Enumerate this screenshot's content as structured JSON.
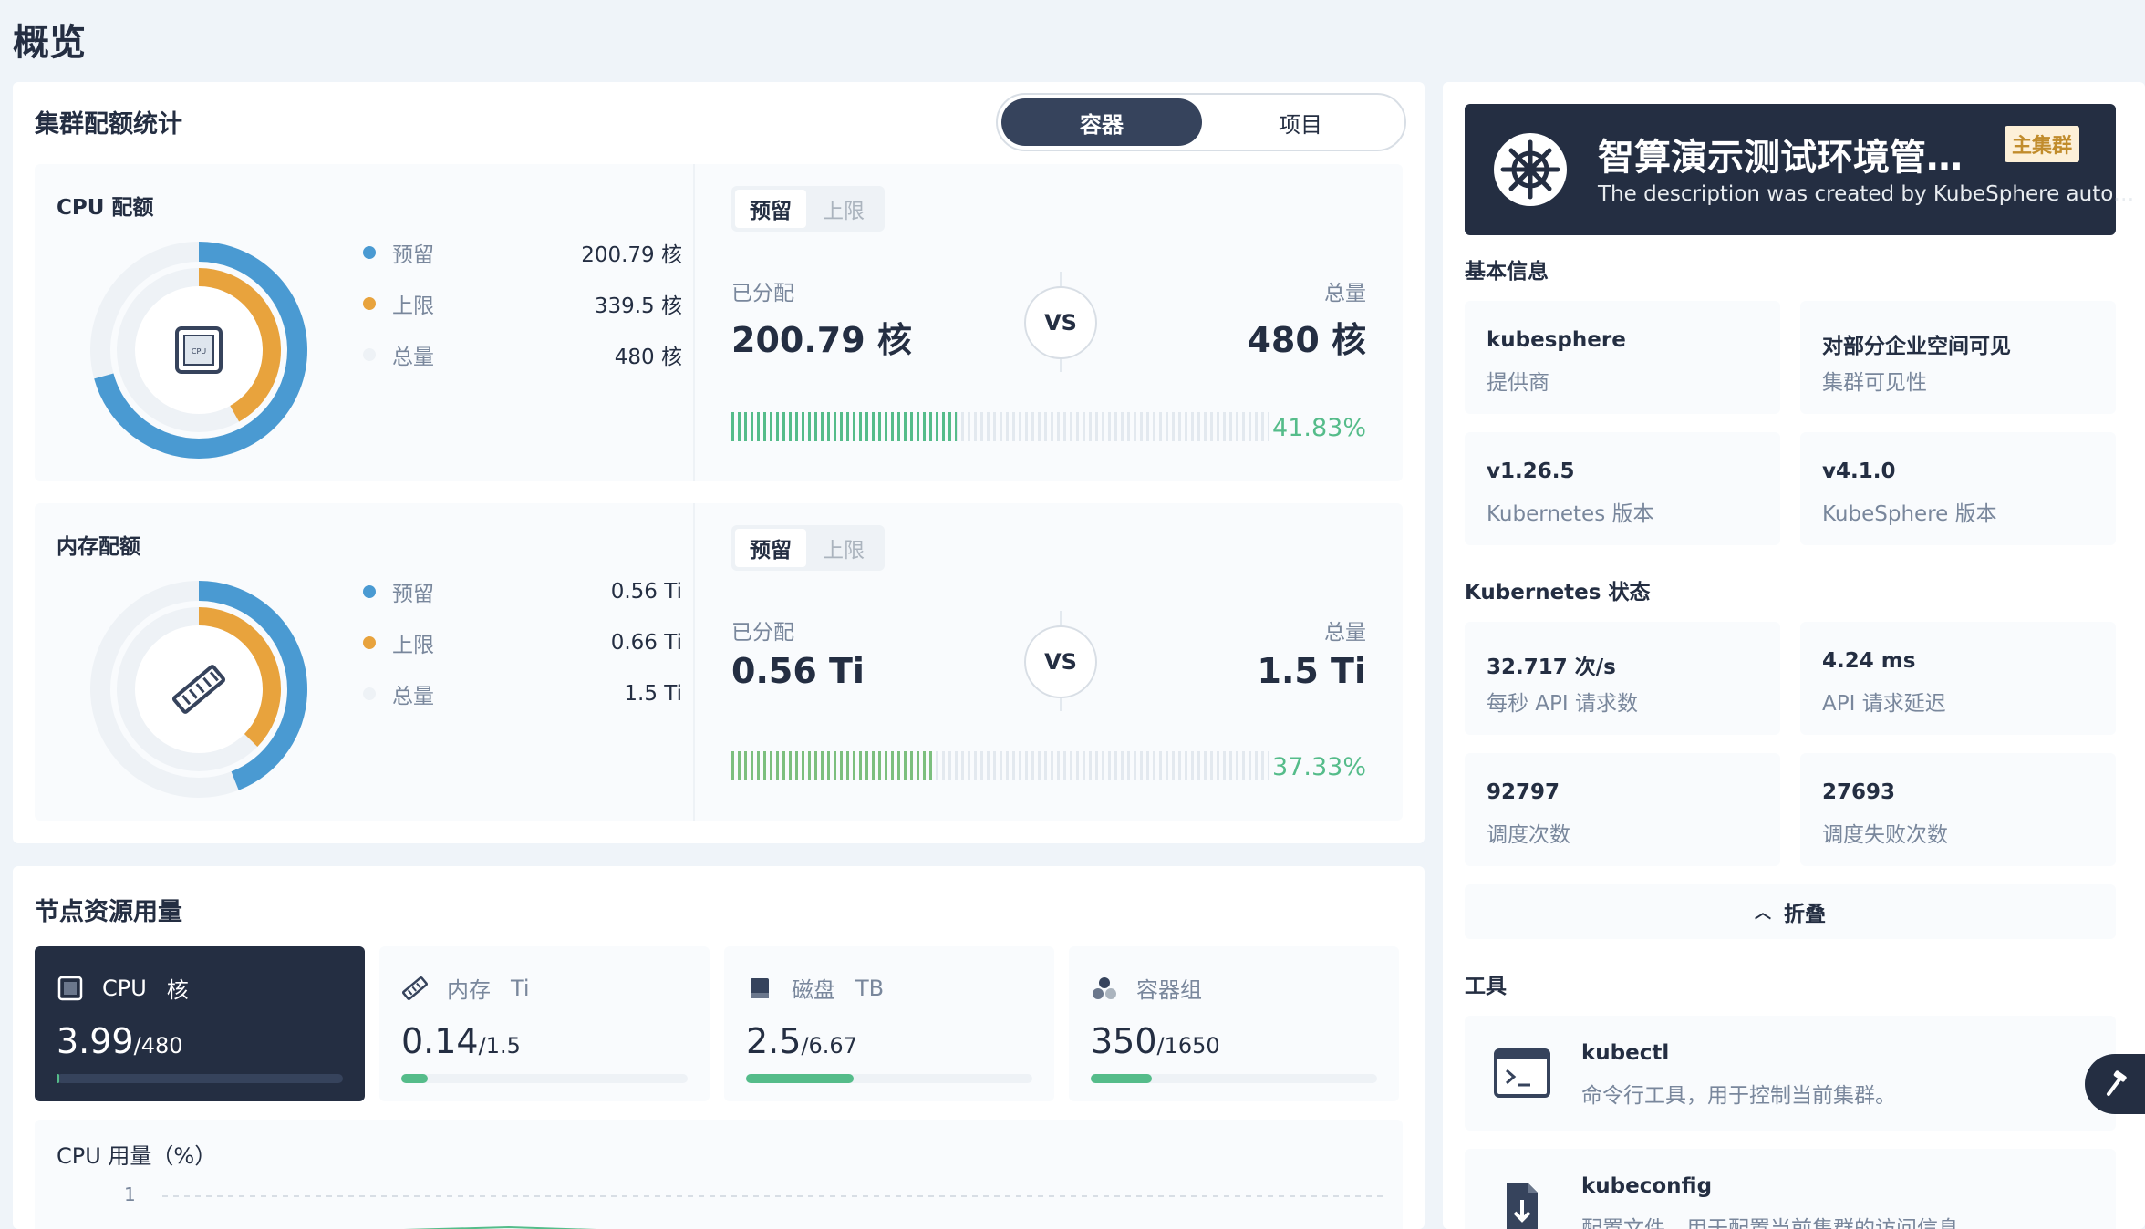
{
  "page": {
    "title": "概览"
  },
  "quota": {
    "title": "集群配额统计",
    "switch": {
      "active": "容器",
      "inactive": "项目"
    },
    "cpu": {
      "title": "CPU 配额",
      "legend": [
        {
          "label": "预留",
          "value": "200.79 核",
          "color": "#4a9ad2"
        },
        {
          "label": "上限",
          "value": "339.5 核",
          "color": "#e8a33d"
        },
        {
          "label": "总量",
          "value": "480 核",
          "color": "#eef2f6"
        }
      ],
      "tabs": {
        "on": "预留",
        "off": "上限"
      },
      "allocated_label": "已分配",
      "allocated_value": "200.79 核",
      "vs": "VS",
      "total_label": "总量",
      "total_value": "480 核",
      "percent": "41.83%",
      "percent_value": 41.83,
      "reserved_fraction": 0.4183,
      "limit_fraction": 0.7073,
      "icon": "cpu-chip-icon"
    },
    "memory": {
      "title": "内存配额",
      "legend": [
        {
          "label": "预留",
          "value": "0.56 Ti",
          "color": "#4a9ad2"
        },
        {
          "label": "上限",
          "value": "0.66 Ti",
          "color": "#e8a33d"
        },
        {
          "label": "总量",
          "value": "1.5 Ti",
          "color": "#eef2f6"
        }
      ],
      "tabs": {
        "on": "预留",
        "off": "上限"
      },
      "allocated_label": "已分配",
      "allocated_value": "0.56 Ti",
      "vs": "VS",
      "total_label": "总量",
      "total_value": "1.5 Ti",
      "percent": "37.33%",
      "percent_value": 37.33,
      "reserved_fraction": 0.3733,
      "limit_fraction": 0.44,
      "icon": "memory-stick-icon"
    }
  },
  "nodes": {
    "title": "节点资源用量",
    "tiles": [
      {
        "name": "CPU",
        "unit": "核",
        "used": "3.99",
        "total": "/480",
        "fraction": 0.0083,
        "icon": "cpu-chip-icon"
      },
      {
        "name": "内存",
        "unit": "Ti",
        "used": "0.14",
        "total": "/1.5",
        "fraction": 0.093,
        "icon": "memory-stick-icon"
      },
      {
        "name": "磁盘",
        "unit": "TB",
        "used": "2.5",
        "total": "/6.67",
        "fraction": 0.375,
        "icon": "disk-icon"
      },
      {
        "name": "容器组",
        "unit": "",
        "used": "350",
        "total": "/1650",
        "fraction": 0.212,
        "icon": "pods-icon"
      }
    ],
    "usage_title": "CPU 用量（%）",
    "usage_tick": "1"
  },
  "cluster": {
    "name": "智算演示测试环境管…",
    "description": "The description was created by KubeSphere auto…",
    "tag": "主集群",
    "basic_title": "基本信息",
    "basic": [
      {
        "value": "kubesphere",
        "label": "提供商"
      },
      {
        "value": "对部分企业空间可见",
        "label": "集群可见性"
      },
      {
        "value": "v1.26.5",
        "label": "Kubernetes 版本"
      },
      {
        "value": "v4.1.0",
        "label": "KubeSphere 版本"
      }
    ],
    "k8s_title": "Kubernetes 状态",
    "k8s": [
      {
        "value": "32.717 次/s",
        "label": "每秒 API 请求数"
      },
      {
        "value": "4.24 ms",
        "label": "API 请求延迟"
      },
      {
        "value": "92797",
        "label": "调度次数"
      },
      {
        "value": "27693",
        "label": "调度失败次数"
      }
    ],
    "collapse_label": "折叠",
    "tools_title": "工具",
    "tools": [
      {
        "name": "kubectl",
        "desc": "命令行工具，用于控制当前集群。",
        "icon": "terminal-icon"
      },
      {
        "name": "kubeconfig",
        "desc": "配置文件，用于配置当前集群的访问信息。",
        "icon": "download-file-icon"
      }
    ]
  },
  "colors": {
    "primary_dark": "#242e42",
    "reserved_blue": "#4a9ad2",
    "limit_orange": "#e8a33d",
    "success_green": "#55bc8a",
    "muted_text": "#79879c"
  }
}
